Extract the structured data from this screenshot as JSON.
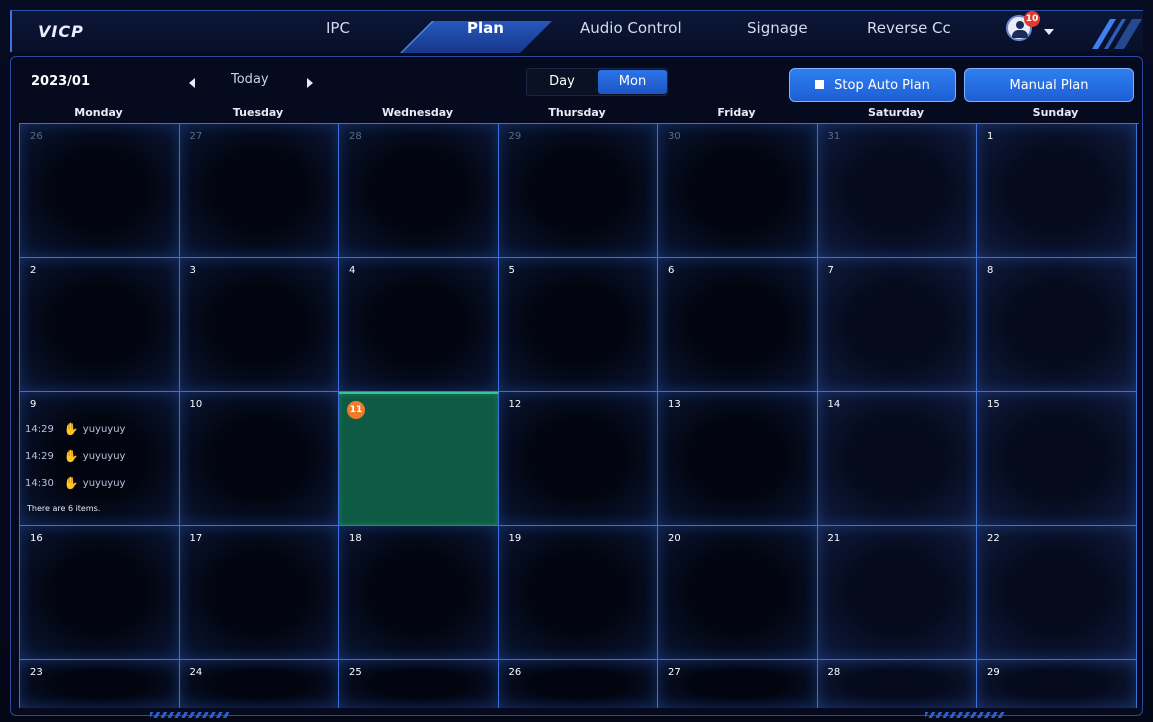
{
  "app": {
    "logo": "VICP"
  },
  "nav": {
    "tabs": [
      {
        "label": "IPC",
        "active": false
      },
      {
        "label": "Plan",
        "active": true
      },
      {
        "label": "Audio Control",
        "active": false
      },
      {
        "label": "Signage",
        "active": false
      },
      {
        "label": "Reverse Cc",
        "active": false
      }
    ],
    "notification_count": "10",
    "accent_color": "#2d74e8"
  },
  "calendar": {
    "month_label": "2023/01",
    "today_label": "Today",
    "view_day_label": "Day",
    "view_mon_label": "Mon",
    "active_view": "Mon",
    "stop_auto_label": "Stop Auto Plan",
    "manual_label": "Manual Plan",
    "weekdays": [
      "Monday",
      "Tuesday",
      "Wednesday",
      "Thursday",
      "Friday",
      "Saturday",
      "Sunday"
    ],
    "today_color": "#0e5a44",
    "badge_color": "#f07c2a",
    "weeks": [
      [
        {
          "day": "26",
          "other": true
        },
        {
          "day": "27",
          "other": true
        },
        {
          "day": "28",
          "other": true
        },
        {
          "day": "29",
          "other": true
        },
        {
          "day": "30",
          "other": true
        },
        {
          "day": "31",
          "other": true
        },
        {
          "day": "1",
          "other": false
        }
      ],
      [
        {
          "day": "2"
        },
        {
          "day": "3"
        },
        {
          "day": "4"
        },
        {
          "day": "5"
        },
        {
          "day": "6"
        },
        {
          "day": "7"
        },
        {
          "day": "8"
        }
      ],
      [
        {
          "day": "9",
          "events": [
            {
              "time": "14:29",
              "name": "yuyuyuy"
            },
            {
              "time": "14:29",
              "name": "yuyuyuy"
            },
            {
              "time": "14:30",
              "name": "yuyuyuy"
            }
          ],
          "more": "There are 6 items."
        },
        {
          "day": "10"
        },
        {
          "day": "11",
          "today": true
        },
        {
          "day": "12"
        },
        {
          "day": "13"
        },
        {
          "day": "14"
        },
        {
          "day": "15"
        }
      ],
      [
        {
          "day": "16"
        },
        {
          "day": "17"
        },
        {
          "day": "18"
        },
        {
          "day": "19"
        },
        {
          "day": "20"
        },
        {
          "day": "21"
        },
        {
          "day": "22"
        }
      ],
      [
        {
          "day": "23"
        },
        {
          "day": "24"
        },
        {
          "day": "25"
        },
        {
          "day": "26"
        },
        {
          "day": "27"
        },
        {
          "day": "28"
        },
        {
          "day": "29"
        }
      ]
    ]
  }
}
